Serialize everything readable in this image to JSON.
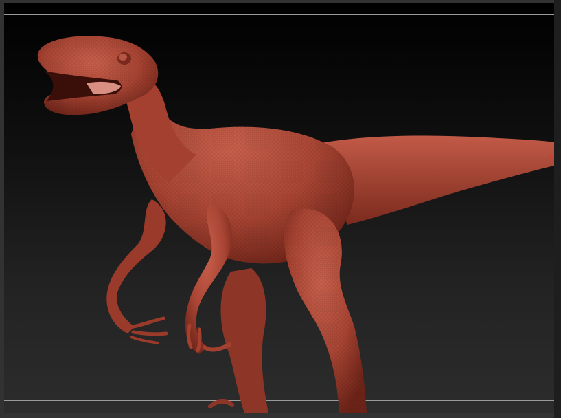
{
  "canvas": {
    "background_top": "#000000",
    "background_bottom": "#2c2c2c",
    "frame_color": "#323232",
    "guide_color": "#9a9a9a"
  },
  "model": {
    "subject": "raptor-sculpt",
    "material_color": "#b04b3a",
    "shadow_color": "#6e2418",
    "highlight_color": "#d27a68"
  }
}
